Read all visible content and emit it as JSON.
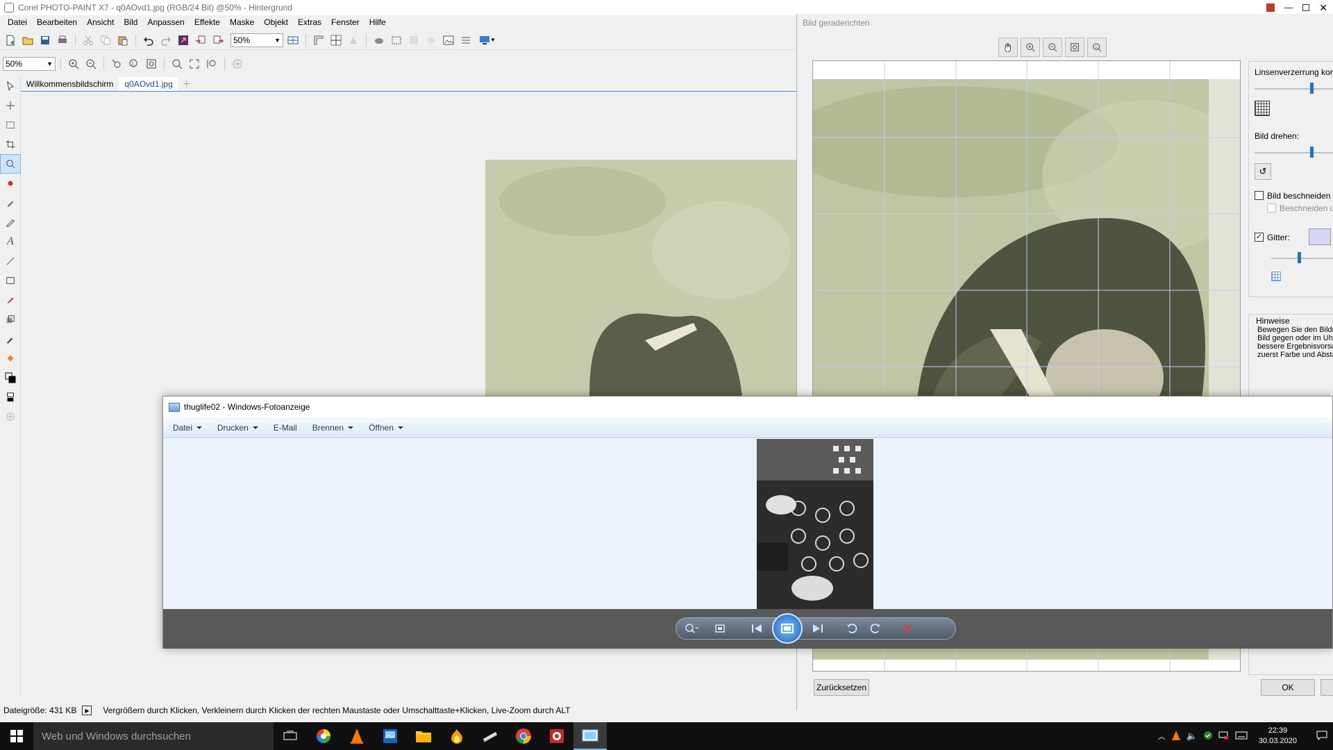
{
  "corel": {
    "title": "Corel PHOTO-PAINT X7 - q0AOvd1.jpg (RGB/24 Bit) @50% - Hintergrund",
    "menu": [
      "Datei",
      "Bearbeiten",
      "Ansicht",
      "Bild",
      "Anpassen",
      "Effekte",
      "Maske",
      "Objekt",
      "Extras",
      "Fenster",
      "Hilfe"
    ],
    "zoom_toolbar1": "50%",
    "zoom_toolbar2": "50%",
    "tabs": [
      "Willkommensbildschirm",
      "q0AOvd1.jpg"
    ],
    "status_filesize": "Dateigröße: 431 KB",
    "status_hint": "Vergrößern durch Klicken, Verkleinern durch Klicken der rechten Maustaste oder Umschalttaste+Klicken, Live-Zoom durch ALT"
  },
  "dialog": {
    "title": "Bild geraderichten",
    "lens_label": "Linsenverzerrung korr",
    "rotate_label": "Bild drehen:",
    "crop_label": "Bild beschneiden",
    "crop_sub_label": "Beschneiden ur",
    "grid_label": "Gitter:",
    "grid_checked": true,
    "crop_checked": false,
    "hints_title": "Hinweise",
    "hints_lines": [
      "Bewegen Sie den Bildre",
      "Bild gegen oder im Uhrz",
      "bessere Ergebnisvorsch",
      "zuerst Farbe und Absta"
    ],
    "reset_button": "Zurücksetzen",
    "ok_button": "OK",
    "grid_color": "#d6d6f7"
  },
  "viewer": {
    "title": "thuglife02 - Windows-Fotoanzeige",
    "menu": [
      {
        "label": "Datei",
        "dropdown": true
      },
      {
        "label": "Drucken",
        "dropdown": true
      },
      {
        "label": "E-Mail",
        "dropdown": false
      },
      {
        "label": "Brennen",
        "dropdown": true
      },
      {
        "label": "Öffnen",
        "dropdown": true
      }
    ]
  },
  "taskbar": {
    "search_placeholder": "Web und Windows durchsuchen",
    "time": "22:39",
    "date": "30.03.2020"
  },
  "colors": {
    "accent": "#1e73d2",
    "photo_tint": "#c6cbab",
    "viewer_bg": "#ebf2fa",
    "controls_bg": "#595959"
  }
}
